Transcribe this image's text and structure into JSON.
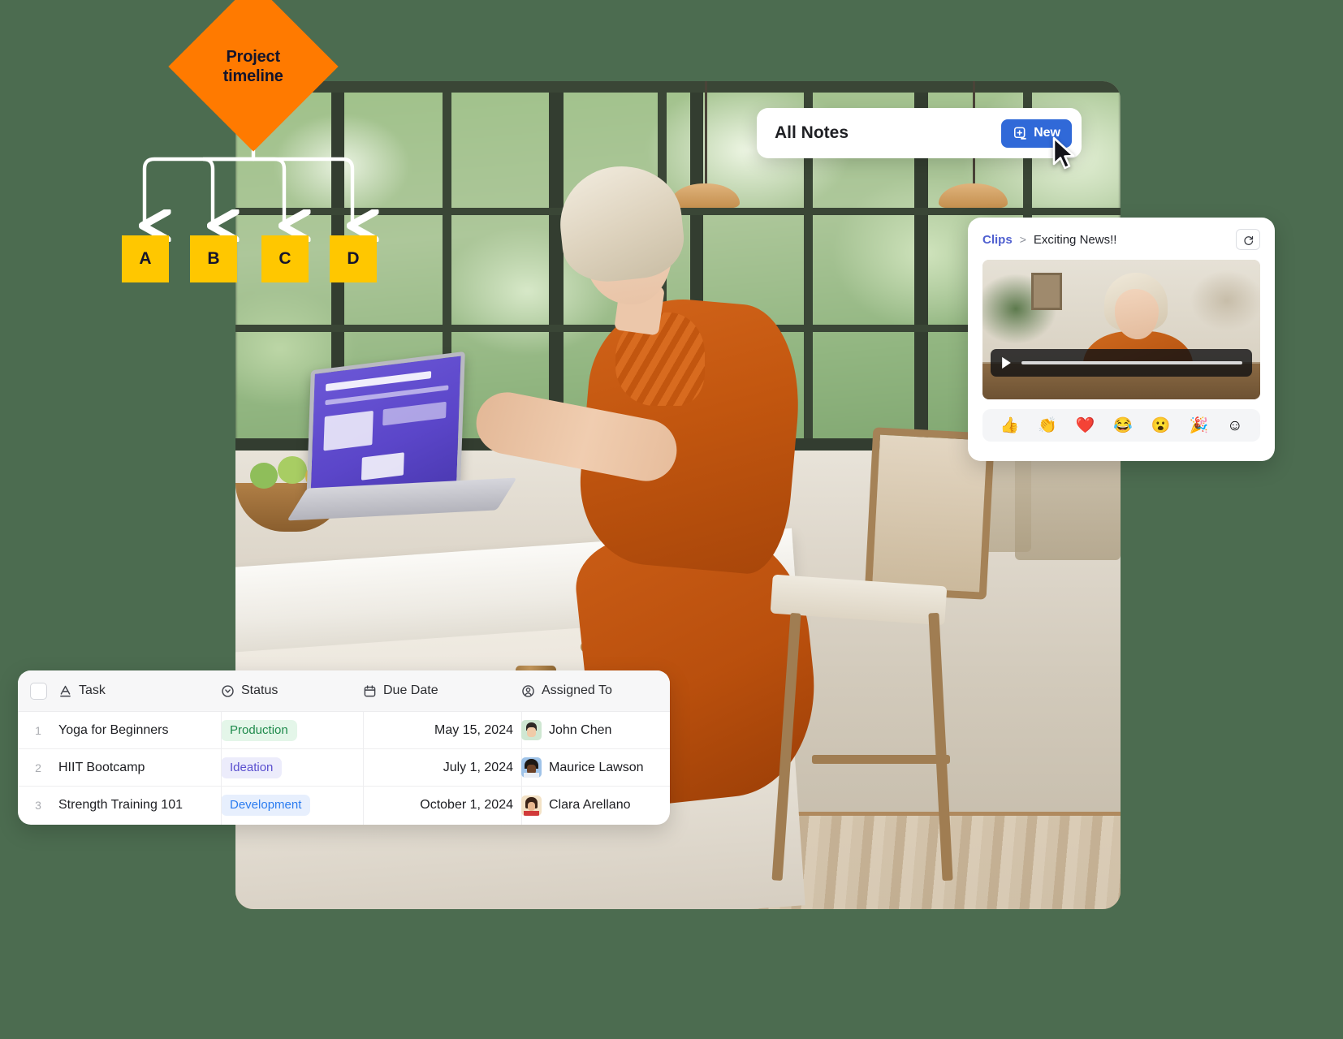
{
  "diagram": {
    "root_label": "Project\ntimeline",
    "root_line1": "Project",
    "root_line2": "timeline",
    "root_color": "#ff7a00",
    "node_color": "#ffc700",
    "nodes": [
      {
        "label": "A"
      },
      {
        "label": "B"
      },
      {
        "label": "C"
      },
      {
        "label": "D"
      }
    ]
  },
  "notes_card": {
    "title": "All Notes",
    "new_label": "New",
    "new_icon": "note-plus-icon",
    "accent": "#3069d8",
    "cursor_icon": "mouse-pointer-icon"
  },
  "clips_card": {
    "breadcrumb_root": "Clips",
    "breadcrumb_separator": ">",
    "breadcrumb_current": "Exciting News!!",
    "refresh_icon": "refresh-icon",
    "play_icon": "play-icon",
    "breadcrumb_link_color": "#5060d0",
    "reactions": [
      {
        "icon": "thumbs-up-emoji",
        "glyph": "👍"
      },
      {
        "icon": "clapping-hands-emoji",
        "glyph": "👏"
      },
      {
        "icon": "red-heart-emoji",
        "glyph": "❤️"
      },
      {
        "icon": "joy-emoji",
        "glyph": "😂"
      },
      {
        "icon": "open-mouth-emoji",
        "glyph": "😮"
      },
      {
        "icon": "party-popper-emoji",
        "glyph": "🎉"
      },
      {
        "icon": "add-reaction-icon",
        "glyph": "☺"
      }
    ]
  },
  "task_table": {
    "columns": [
      {
        "label": "Task",
        "icon": "text-field-icon"
      },
      {
        "label": "Status",
        "icon": "select-field-icon"
      },
      {
        "label": "Due Date",
        "icon": "calendar-icon"
      },
      {
        "label": "Assigned To",
        "icon": "person-icon"
      }
    ],
    "rows": [
      {
        "number": "1",
        "task": "Yoga for Beginners",
        "status": "Production",
        "status_bg": "#e4f6e9",
        "status_fg": "#1f8a4c",
        "due_date": "May 15, 2024",
        "assignee": "John Chen",
        "avatar_bg": "#cfe7d2"
      },
      {
        "number": "2",
        "task": "HIIT Bootcamp",
        "status": "Ideation",
        "status_bg": "#ececfb",
        "status_fg": "#5a4fcf",
        "due_date": "July 1, 2024",
        "assignee": "Maurice Lawson",
        "avatar_bg": "#9fc3e8"
      },
      {
        "number": "3",
        "task": "Strength Training 101",
        "status": "Development",
        "status_bg": "#e7effd",
        "status_fg": "#2b7cf0",
        "due_date": "October 1, 2024",
        "assignee": "Clara Arellano",
        "avatar_bg": "#f3e2c6"
      }
    ]
  }
}
